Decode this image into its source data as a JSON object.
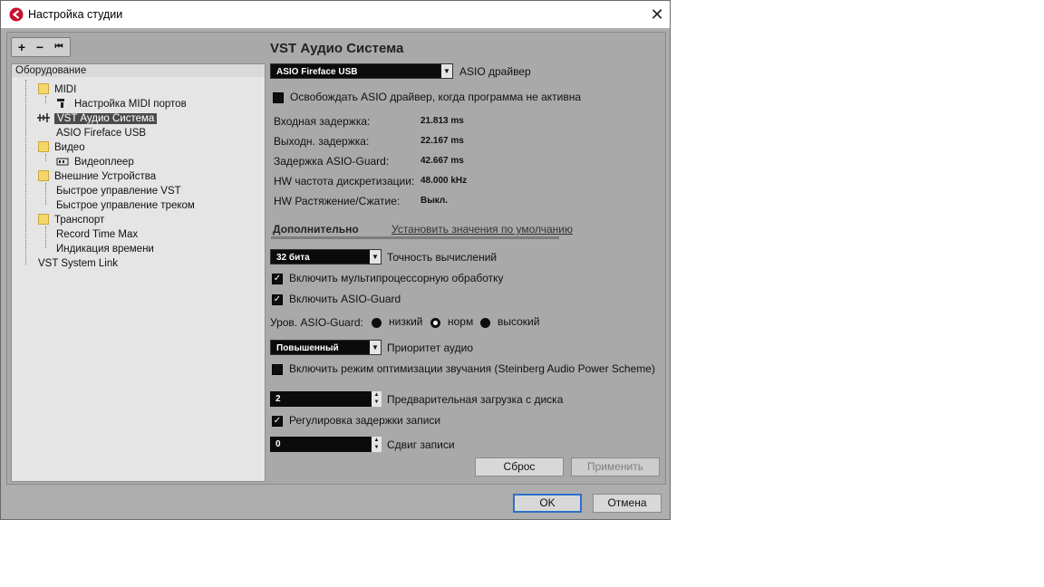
{
  "window": {
    "title": "Настройка студии",
    "close_glyph": "✕"
  },
  "toolbar": {
    "add": "+",
    "remove": "−",
    "first": "⏮"
  },
  "tree": {
    "root": "Оборудование",
    "items": [
      {
        "label": "MIDI",
        "icon": "folder-icon"
      },
      {
        "label": "Настройка MIDI портов",
        "icon": "midi-port-icon"
      },
      {
        "label": "VST Аудио Система",
        "icon": "audio-system-icon"
      },
      {
        "label": "ASIO Fireface USB",
        "icon": ""
      },
      {
        "label": "Видео",
        "icon": "folder-icon"
      },
      {
        "label": "Видеоплеер",
        "icon": "video-player-icon"
      },
      {
        "label": "Внешние Устройства",
        "icon": "folder-icon"
      },
      {
        "label": "Быстрое управление VST",
        "icon": ""
      },
      {
        "label": "Быстрое управление треком",
        "icon": ""
      },
      {
        "label": "Транспорт",
        "icon": "folder-icon"
      },
      {
        "label": "Record Time Max",
        "icon": ""
      },
      {
        "label": "Индикация времени",
        "icon": ""
      },
      {
        "label": "VST System Link",
        "icon": ""
      }
    ]
  },
  "panel": {
    "heading": "VST Аудио Система",
    "driver_select": "ASIO Fireface USB",
    "driver_label": "ASIO драйвер",
    "release_driver": "Освобождать ASIO драйвер, когда программа не активна",
    "stats": [
      {
        "label": "Входная задержка:",
        "value": "21.813 ms"
      },
      {
        "label": "Выходн. задержка:",
        "value": "22.167 ms"
      },
      {
        "label": "Задержка ASIO-Guard:",
        "value": "42.667 ms"
      },
      {
        "label": "HW частота дискретизации:",
        "value": "48.000 kHz"
      },
      {
        "label": "HW Растяжение/Сжатие:",
        "value": "Выкл."
      }
    ],
    "tab_advanced": "Дополнительно",
    "tab_defaults": "Установить значения по умолчанию",
    "precision_select": "32 бита",
    "precision_label": "Точность вычислений",
    "multiproc": "Включить мультипроцессорную обработку",
    "asio_guard": "Включить ASIO-Guard",
    "guard_level_label": "Уров. ASIO-Guard:",
    "guard_low": "низкий",
    "guard_normal": "норм",
    "guard_high": "высокий",
    "priority_select": "Повышенный",
    "priority_label": "Приоритет аудио",
    "power_scheme": "Включить режим оптимизации звучания (Steinberg Audio Power Scheme)",
    "disk_preload_value": "2",
    "disk_preload_label": "Предварительная загрузка с диска",
    "record_latency": "Регулировка задержки записи",
    "record_shift_value": "0",
    "record_shift_label": "Сдвиг записи",
    "reset": "Сброс",
    "apply": "Применить"
  },
  "footer": {
    "ok": "OK",
    "cancel": "Отмена"
  }
}
